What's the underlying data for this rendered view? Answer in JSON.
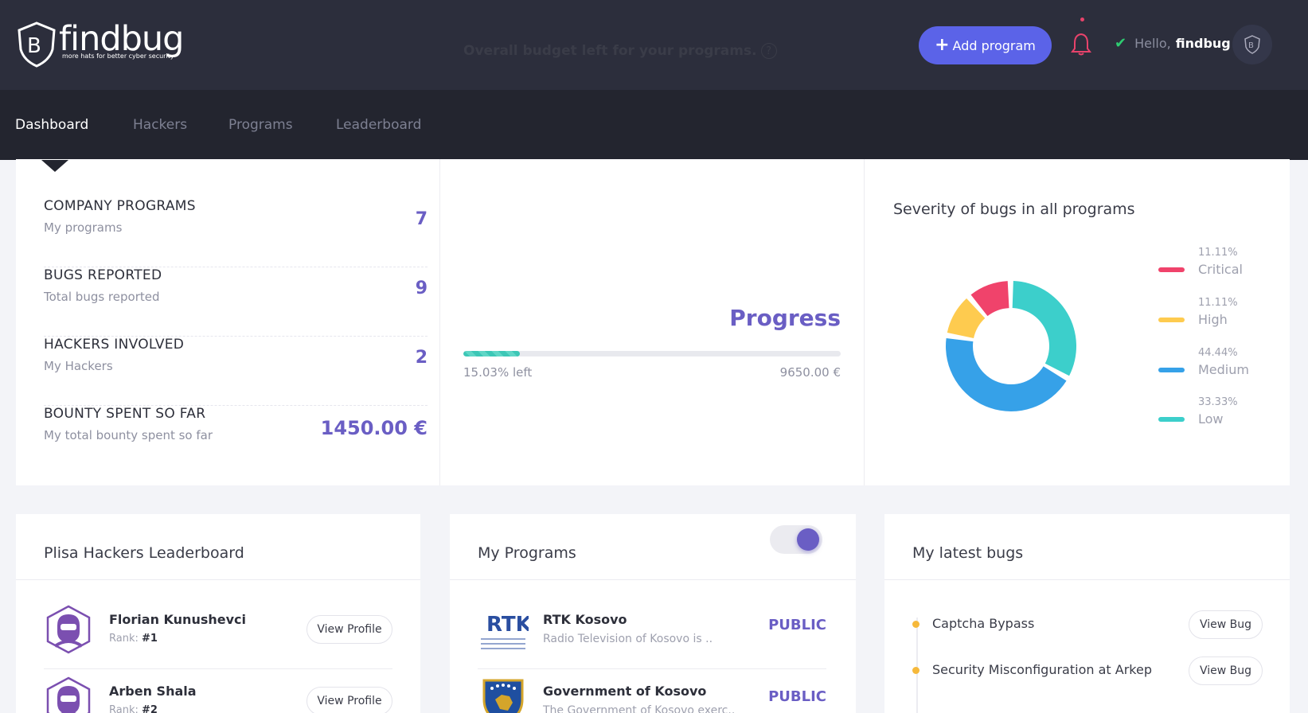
{
  "header": {
    "brand": "findbug",
    "tagline": "more hats for better cyber security",
    "add_button_label": "Add program",
    "greeting": "Hello,",
    "username": "findbug"
  },
  "nav": {
    "items": [
      {
        "label": "Dashboard",
        "active": true
      },
      {
        "label": "Hackers",
        "active": false
      },
      {
        "label": "Programs",
        "active": false
      },
      {
        "label": "Leaderboard",
        "active": false
      }
    ]
  },
  "stats": [
    {
      "title": "COMPANY PROGRAMS",
      "subtitle": "My programs",
      "value": "7"
    },
    {
      "title": "BUGS REPORTED",
      "subtitle": "Total bugs reported",
      "value": "9"
    },
    {
      "title": "HACKERS INVOLVED",
      "subtitle": "My Hackers",
      "value": "2"
    },
    {
      "title": "BOUNTY SPENT SO FAR",
      "subtitle": "My total bounty spent so far",
      "value": "1450.00 €"
    }
  ],
  "budget": {
    "title": "Overall budget left for your programs.",
    "help_glyph": "?",
    "progress_label": "Progress",
    "left_text": "15.03% left",
    "left_fraction": 0.1503,
    "total_text": "9650.00 €"
  },
  "severity": {
    "title": "Severity of bugs in all programs",
    "items": [
      {
        "label": "Critical",
        "percent": "11.11%",
        "value": 11.11,
        "color": "#f0436b"
      },
      {
        "label": "High",
        "percent": "11.11%",
        "value": 11.11,
        "color": "#fecb4f"
      },
      {
        "label": "Medium",
        "percent": "44.44%",
        "value": 44.44,
        "color": "#36a1e8"
      },
      {
        "label": "Low",
        "percent": "33.33%",
        "value": 33.33,
        "color": "#3ccfcb"
      }
    ]
  },
  "leaderboard": {
    "title": "Plisa Hackers Leaderboard",
    "rank_label": "Rank:",
    "button_label": "View Profile",
    "hackers": [
      {
        "name": "Florian Kunushevci",
        "rank": "#1"
      },
      {
        "name": "Arben Shala",
        "rank": "#2"
      }
    ]
  },
  "programs": {
    "title": "My Programs",
    "toggle_on": true,
    "items": [
      {
        "name": "RTK Kosovo",
        "desc": "Radio Television of Kosovo is ..",
        "badge": "PUBLIC",
        "logo_text": "RTK"
      },
      {
        "name": "Government of Kosovo",
        "desc": "The Government of Kosovo exerc..",
        "badge": "PUBLIC",
        "logo_text": ""
      }
    ]
  },
  "bugs": {
    "title": "My latest bugs",
    "button_label": "View Bug",
    "items": [
      {
        "title": "Captcha Bypass"
      },
      {
        "title": "Security Misconfiguration at Arkep"
      }
    ]
  },
  "colors": {
    "accent": "#5b63e8",
    "purple": "#6a5ec4",
    "topbar": "#2c2e3c",
    "navbar": "#23252f"
  }
}
